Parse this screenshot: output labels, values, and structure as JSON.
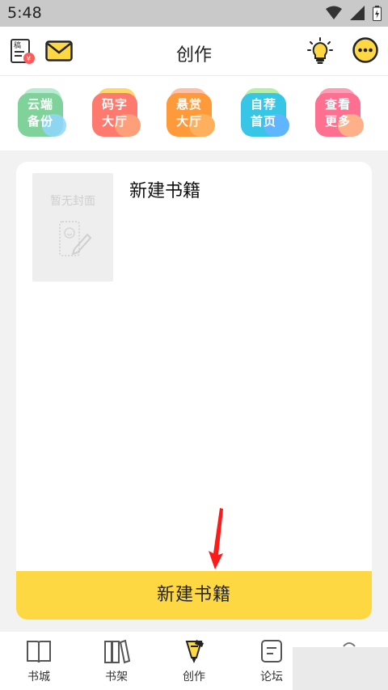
{
  "status": {
    "time": "5:48"
  },
  "header": {
    "title": "创作",
    "draft_badge_text": "稿"
  },
  "quick_actions": [
    {
      "line1": "云端",
      "line2": "备份",
      "color": "#7fd39a"
    },
    {
      "line1": "码字",
      "line2": "大厅",
      "color": "#ff7a6e"
    },
    {
      "line1": "悬赏",
      "line2": "大厅",
      "color": "#ff9a3a"
    },
    {
      "line1": "自荐",
      "line2": "首页",
      "color": "#37c6e6"
    },
    {
      "line1": "查看",
      "line2": "更多",
      "color": "#ff6f8f"
    }
  ],
  "book": {
    "cover_placeholder": "暂无封面",
    "title": "新建书籍"
  },
  "create_button": {
    "label": "新建书籍"
  },
  "nav": [
    {
      "label": "书城",
      "icon": "book-open-icon"
    },
    {
      "label": "书架",
      "icon": "bookshelf-icon"
    },
    {
      "label": "创作",
      "icon": "pen-icon"
    },
    {
      "label": "论坛",
      "icon": "forum-icon"
    },
    {
      "label": "",
      "icon": "profile-icon"
    }
  ],
  "colors": {
    "accent": "#fdd843",
    "background": "#f2f2f2",
    "arrow": "#ff1a1a"
  }
}
